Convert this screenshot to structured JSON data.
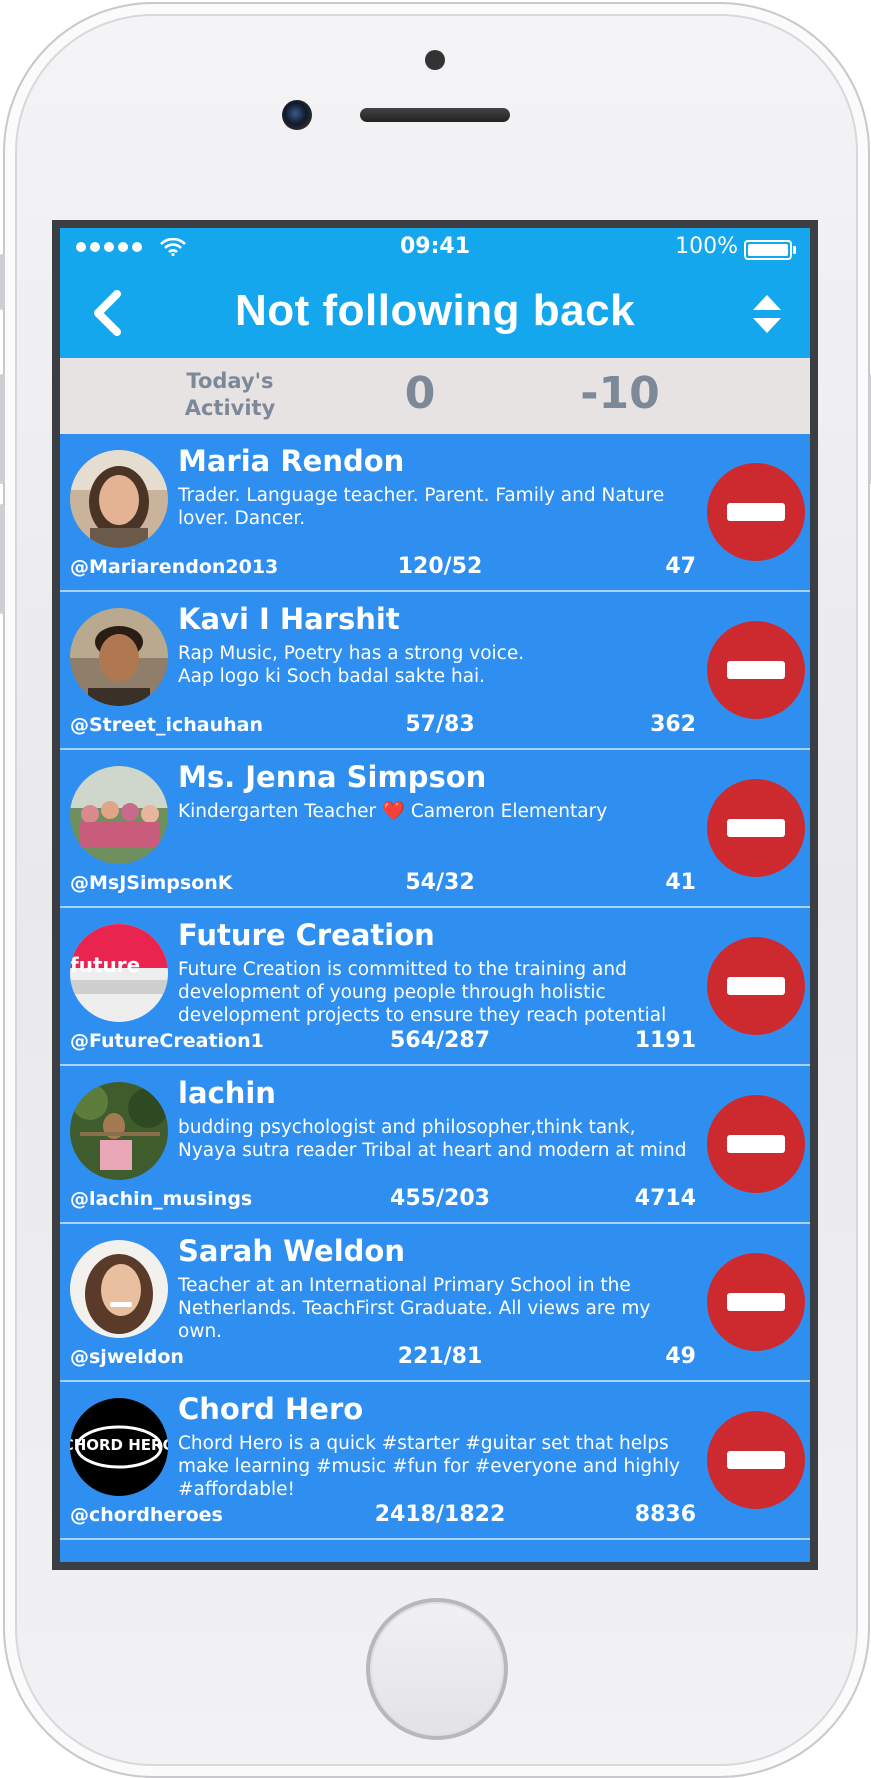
{
  "status_bar": {
    "time": "09:41",
    "battery": "100%"
  },
  "nav": {
    "title": "Not following back"
  },
  "activity": {
    "label": "Today's Activity",
    "value1": "0",
    "value2": "-10"
  },
  "users": [
    {
      "name": "Maria Rendon",
      "bio": "Trader. Language teacher. Parent. Family and Nature lover. Dancer.",
      "handle": "@Mariarendon2013",
      "ratio": "120/52",
      "count": "47"
    },
    {
      "name": "Kavi I Harshit",
      "bio": "Rap Music, Poetry has a strong voice.\nAap logo ki Soch badal sakte hai.",
      "handle": "@Street_ichauhan",
      "ratio": "57/83",
      "count": "362"
    },
    {
      "name": "Ms. Jenna Simpson",
      "bio": "Kindergarten Teacher ❤️ Cameron Elementary",
      "handle": "@MsJSimpsonK",
      "ratio": "54/32",
      "count": "41"
    },
    {
      "name": "Future Creation",
      "bio": "Future Creation is committed to the training and development of young people through holistic development projects to ensure they reach potential",
      "handle": "@FutureCreation1",
      "ratio": "564/287",
      "count": "1191"
    },
    {
      "name": "lachin",
      "bio": "budding psychologist and philosopher,think tank, Nyaya sutra reader Tribal at heart and modern at mind",
      "handle": "@lachin_musings",
      "ratio": "455/203",
      "count": "4714"
    },
    {
      "name": "Sarah Weldon",
      "bio": "Teacher at an International  Primary School in the Netherlands. TeachFirst Graduate. All views are my own.",
      "handle": "@sjweldon",
      "ratio": "221/81",
      "count": "49"
    },
    {
      "name": "Chord Hero",
      "bio": "Chord Hero is a quick #starter #guitar set that helps make learning #music #fun for #everyone and highly #affordable!",
      "handle": "@chordheroes",
      "ratio": "2418/1822",
      "count": "8836"
    }
  ],
  "chord_logo_text": "CHORD HERO",
  "future_logo_text": "future",
  "colors": {
    "nav_blue": "#15a7ee",
    "row_blue": "#2f8ff0",
    "unfollow_red": "#cc2a2f",
    "activity_bg": "#e8e3e3"
  }
}
